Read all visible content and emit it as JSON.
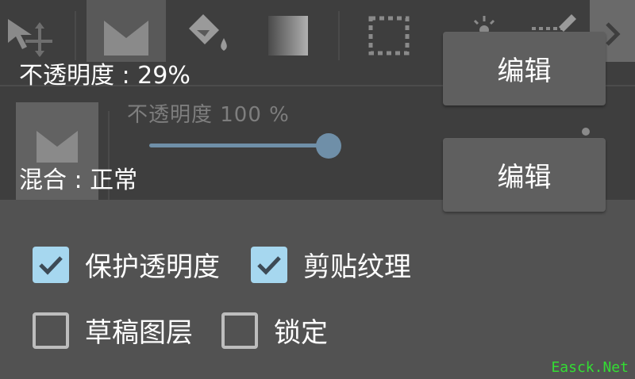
{
  "toolbar": {
    "tools": [
      {
        "icon": "move-tool-icon"
      },
      {
        "icon": "layer-mask-icon",
        "selected": true
      },
      {
        "icon": "paint-bucket-icon"
      },
      {
        "icon": "gradient-icon"
      },
      {
        "icon": "marquee-select-icon"
      },
      {
        "icon": "brightness-icon"
      },
      {
        "icon": "pencil-select-icon"
      },
      {
        "icon": "chevron-right-icon"
      }
    ]
  },
  "layer_panel": {
    "opacity_text": "不透明度  100  %",
    "opacity_value": 100
  },
  "properties": {
    "opacity_label": "不透明度 : 29%",
    "blend_label": "混合 : 正常",
    "edit_label": "编辑"
  },
  "options": [
    {
      "label": "保护透明度",
      "checked": true
    },
    {
      "label": "剪贴纹理",
      "checked": true
    },
    {
      "label": "草稿图层",
      "checked": false
    },
    {
      "label": "锁定",
      "checked": false
    }
  ],
  "watermark": "Easck.Net",
  "colors": {
    "accent": "#a6d7ef",
    "slider": "#6f8fa8",
    "background": "#525252",
    "watermark": "#33dd33"
  }
}
